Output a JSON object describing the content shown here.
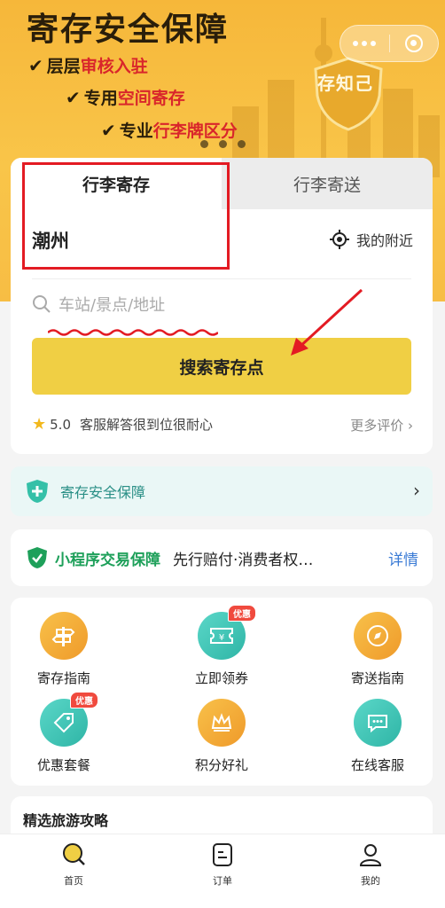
{
  "banner": {
    "title": "寄存安全保障",
    "features": [
      {
        "check": "✔",
        "plain": "层层",
        "highlight": "审核入驻"
      },
      {
        "check": "✔",
        "plain": "专用",
        "highlight": "空间寄存"
      },
      {
        "check": "✔",
        "plain": "专业",
        "highlight": "行李牌区分"
      }
    ],
    "shield_text": "存知己"
  },
  "tabs": {
    "active": "行李寄存",
    "inactive": "行李寄送"
  },
  "location": {
    "city": "潮州",
    "nearby": "我的附近"
  },
  "search": {
    "placeholder": "车站/景点/地址",
    "button": "搜索寄存点"
  },
  "rating": {
    "score": "5.0",
    "comment": "客服解答很到位很耐心",
    "more": "更多评价"
  },
  "safety": {
    "label": "寄存安全保障"
  },
  "guarantee": {
    "label": "小程序交易保障",
    "desc": "先行赔付·消费者权…",
    "detail": "详情"
  },
  "services": [
    {
      "label": "寄存指南",
      "icon": "signpost-icon",
      "color": "#f3a73a"
    },
    {
      "label": "立即领券",
      "icon": "coupon-icon",
      "color": "#3ec7b8",
      "badge": "优惠"
    },
    {
      "label": "寄送指南",
      "icon": "compass-icon",
      "color": "#f3a73a"
    },
    {
      "label": "优惠套餐",
      "icon": "tag-icon",
      "color": "#3ec7b8",
      "badge": "优惠"
    },
    {
      "label": "积分好礼",
      "icon": "crown-icon",
      "color": "#f3a73a"
    },
    {
      "label": "在线客服",
      "icon": "chat-icon",
      "color": "#3ec7b8"
    }
  ],
  "guide": {
    "title": "精选旅游攻略"
  },
  "tabbar": [
    {
      "label": "首页",
      "icon": "home-search-icon"
    },
    {
      "label": "订单",
      "icon": "order-icon"
    },
    {
      "label": "我的",
      "icon": "user-icon"
    }
  ],
  "colors": {
    "accent": "#f0cf44",
    "banner": "#f9c549",
    "highlight": "#d9262b",
    "teal": "#3ec7b8",
    "green": "#1ea05a",
    "link": "#3a7bd5"
  }
}
